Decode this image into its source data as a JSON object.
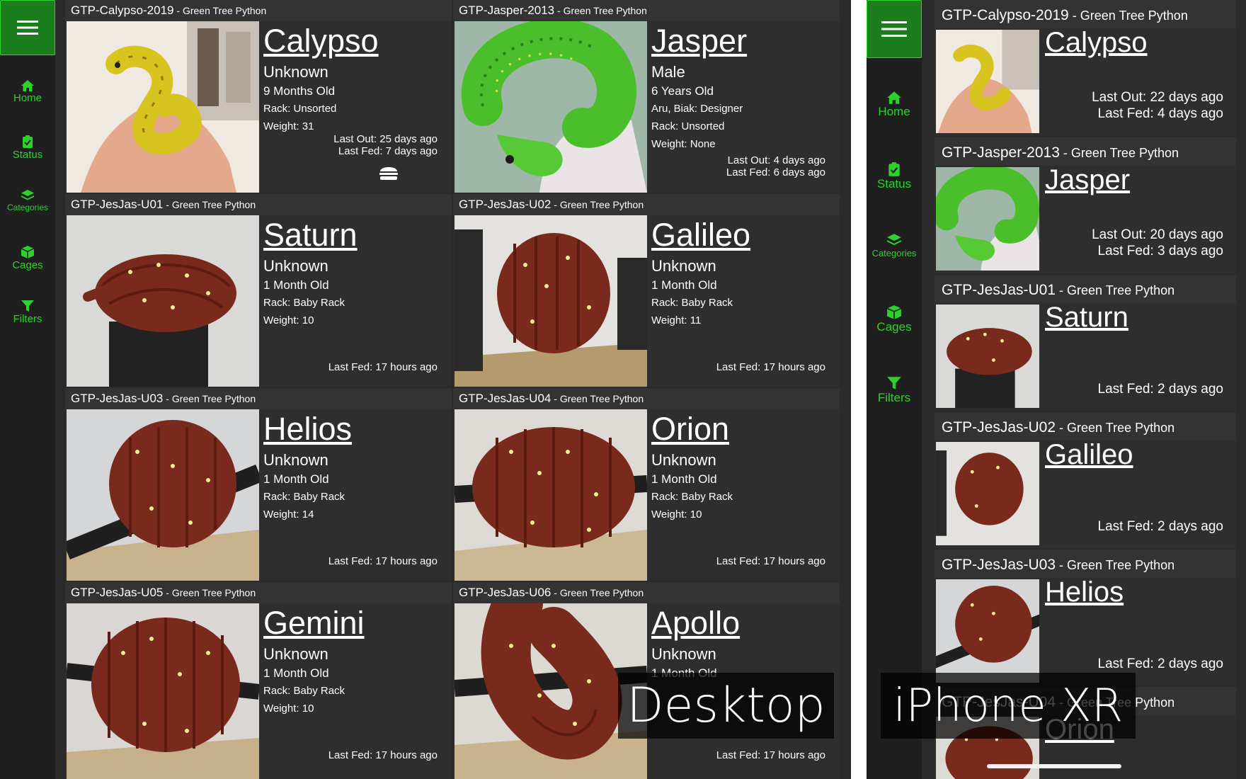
{
  "nav": {
    "items": [
      {
        "label": "Home",
        "icon": "home-icon"
      },
      {
        "label": "Status",
        "icon": "clipboard-check-icon"
      },
      {
        "label": "Categories",
        "icon": "layers-icon"
      },
      {
        "label": "Cages",
        "icon": "box-icon"
      },
      {
        "label": "Filters",
        "icon": "filter-icon"
      }
    ],
    "menu_icon": "hamburger-icon"
  },
  "desktop": {
    "overlay_label": "Desktop",
    "cards": [
      {
        "id": "GTP-Calypso-2019",
        "species": " - Green Tree Python",
        "name": "Calypso",
        "sex": "Unknown",
        "age": "9 Months Old",
        "lines": [
          "Rack: Unsorted",
          "Weight: 31"
        ],
        "times": [
          "Last Out: 25 days ago",
          "Last Fed: 7 days ago"
        ],
        "feed_icon": "hamburger-food-icon"
      },
      {
        "id": "GTP-Jasper-2013",
        "species": " - Green Tree Python",
        "name": "Jasper",
        "sex": "Male",
        "age": "6 Years Old",
        "lines": [
          "Aru, Biak: Designer",
          "Rack: Unsorted",
          "Weight: None"
        ],
        "times": [
          "Last Out: 4 days ago",
          "Last Fed: 6 days ago"
        ]
      },
      {
        "id": "GTP-JesJas-U01",
        "species": " - Green Tree Python",
        "name": "Saturn",
        "sex": "Unknown",
        "age": "1 Month Old",
        "lines": [
          "Rack: Baby Rack",
          "Weight: 10"
        ],
        "times": [
          "Last Fed: 17 hours ago"
        ]
      },
      {
        "id": "GTP-JesJas-U02",
        "species": " - Green Tree Python",
        "name": "Galileo",
        "sex": "Unknown",
        "age": "1 Month Old",
        "lines": [
          "Rack: Baby Rack",
          "Weight: 11"
        ],
        "times": [
          "Last Fed: 17 hours ago"
        ]
      },
      {
        "id": "GTP-JesJas-U03",
        "species": " - Green Tree Python",
        "name": "Helios",
        "sex": "Unknown",
        "age": "1 Month Old",
        "lines": [
          "Rack: Baby Rack",
          "Weight: 14"
        ],
        "times": [
          "Last Fed: 17 hours ago"
        ]
      },
      {
        "id": "GTP-JesJas-U04",
        "species": " - Green Tree Python",
        "name": "Orion",
        "sex": "Unknown",
        "age": "1 Month Old",
        "lines": [
          "Rack: Baby Rack",
          "Weight: 10"
        ],
        "times": [
          "Last Fed: 17 hours ago"
        ]
      },
      {
        "id": "GTP-JesJas-U05",
        "species": " - Green Tree Python",
        "name": "Gemini",
        "sex": "Unknown",
        "age": "1 Month Old",
        "lines": [
          "Rack: Baby Rack",
          "Weight: 10"
        ],
        "times": [
          "Last Fed: 17 hours ago"
        ]
      },
      {
        "id": "GTP-JesJas-U06",
        "species": " - Green Tree Python",
        "name": "Apollo",
        "sex": "Unknown",
        "age": "1 Month Old",
        "lines": [],
        "times": [
          "Last Fed: 17 hours ago"
        ]
      }
    ]
  },
  "mobile": {
    "overlay_label": "iPhone XR",
    "cards": [
      {
        "id": "GTP-Calypso-2019",
        "species": " - Green Tree Python",
        "name": "Calypso",
        "times": [
          "Last Out: 22 days ago",
          "Last Fed: 4 days ago"
        ]
      },
      {
        "id": "GTP-Jasper-2013",
        "species": " - Green Tree Python",
        "name": "Jasper",
        "times": [
          "Last Out: 20 days ago",
          "Last Fed: 3 days ago"
        ]
      },
      {
        "id": "GTP-JesJas-U01",
        "species": " - Green Tree Python",
        "name": "Saturn",
        "times": [
          "Last Fed: 2 days ago"
        ]
      },
      {
        "id": "GTP-JesJas-U02",
        "species": " - Green Tree Python",
        "name": "Galileo",
        "times": [
          "Last Fed: 2 days ago"
        ]
      },
      {
        "id": "GTP-JesJas-U03",
        "species": " - Green Tree Python",
        "name": "Helios",
        "times": [
          "Last Fed: 2 days ago"
        ]
      },
      {
        "id": "GTP-JesJas-U04",
        "species": " - Green Tree Python",
        "name": "Orion",
        "times": []
      }
    ]
  },
  "colors": {
    "accent": "#2ed02e",
    "menu_bg": "#1c7d1c",
    "yellow_snake": "#d8c41e",
    "green_snake": "#4bbf2b",
    "red_snake": "#7a2a1c"
  }
}
